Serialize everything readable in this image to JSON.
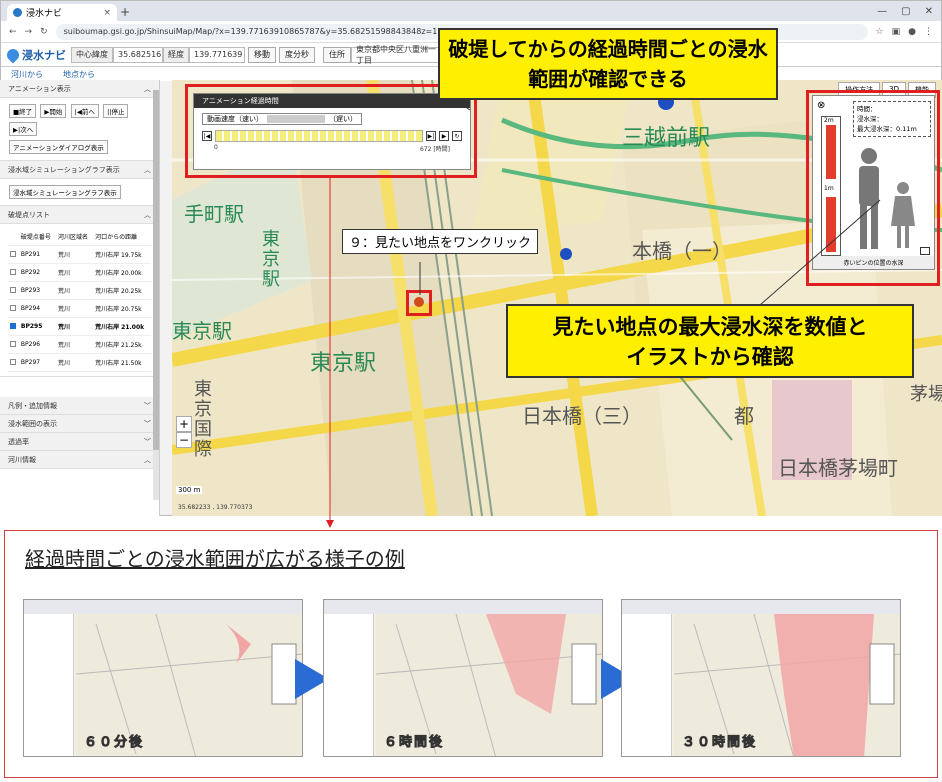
{
  "browser": {
    "tab_title": "浸水ナビ",
    "url": "suiboumap.gsi.go.jp/ShinsuiMap/Map/?x=139.77163910865787&y=35.68251598843848z=17"
  },
  "appbar": {
    "logo": "浸水ナビ",
    "lat_label": "中心緯度",
    "lat_value": "35.682516",
    "lon_label": "経度",
    "lon_value": "139.771639",
    "move_btn": "移動",
    "deg_btn": "度分秒",
    "addr_label": "住所",
    "addr_value": "東京都中央区八重洲一丁目"
  },
  "subbar": {
    "from_river": "河川から",
    "from_point": "地点から"
  },
  "sidebar": {
    "anim_title": "アニメーション表示",
    "anim_buttons": [
      "■終了",
      "▶開始",
      "|◀前へ",
      "||停止",
      "▶|次へ"
    ],
    "anim_dialog_btn": "アニメーションダイアログ表示",
    "graph_title": "浸水域シミュレーショングラフ表示",
    "graph_btn": "浸水域シミュレーショングラフ表示",
    "list_title": "破堤点リスト",
    "list_headers": [
      "破堤点番号",
      "河川区域名",
      "河口からの距離"
    ],
    "list_rows": [
      {
        "id": "BP291",
        "river": "荒川",
        "dist": "荒川右岸 19.75k"
      },
      {
        "id": "BP292",
        "river": "荒川",
        "dist": "荒川右岸 20.00k"
      },
      {
        "id": "BP293",
        "river": "荒川",
        "dist": "荒川右岸 20.25k"
      },
      {
        "id": "BP294",
        "river": "荒川",
        "dist": "荒川右岸 20.75k"
      },
      {
        "id": "BP295",
        "river": "荒川",
        "dist": "荒川右岸 21.00k"
      },
      {
        "id": "BP296",
        "river": "荒川",
        "dist": "荒川右岸 21.25k"
      },
      {
        "id": "BP297",
        "river": "荒川",
        "dist": "荒川右岸 21.50k"
      }
    ],
    "collapsed": [
      "凡例・追加情報",
      "浸水範囲の表示",
      "透過率",
      "河川情報"
    ]
  },
  "anim_panel": {
    "title": "アニメーション経過時間",
    "speed_label": "動画速度（速い）",
    "speed_right": "（遅い）",
    "start": "0",
    "end": "672",
    "unit": "[時間]"
  },
  "depth_panel": {
    "time_label": "時間：",
    "depth_label": "浸水深：",
    "max_label": "最大浸水深：0.11m",
    "scale_2m": "2m",
    "scale_1m": "1m",
    "caption": "赤いピンの位置の水深"
  },
  "map_tools": [
    "操作方法",
    "3D",
    "機能"
  ],
  "map_labels": {
    "mitsukoshi": "三越前駅",
    "otemachi": "手町駅",
    "tokyo_v": "東京",
    "tokyo_v2": "東京駅",
    "tokyo_station": "東京駅",
    "tokyo_left": "東京駅",
    "nihonbashi1": "本橋（一）",
    "nihonbashi3": "日本橋（三）",
    "kokusai": "東京国際",
    "kayaba": "日本橋茅場町",
    "miyako": "都",
    "kaya": "茅場",
    "scale": "300 m",
    "coord": "35.682233 , 139.770373"
  },
  "callouts": {
    "top": "破堤してからの経過時間ごとの浸水範囲が確認できる",
    "click": "９：見たい地点をワンクリック",
    "depth": "見たい地点の最大浸水深を数値とイラストから確認"
  },
  "example": {
    "title": "経過時間ごとの浸水範囲が広がる様子の例",
    "thumbs": [
      "６０分後",
      "６時間後",
      "３０時間後"
    ]
  }
}
